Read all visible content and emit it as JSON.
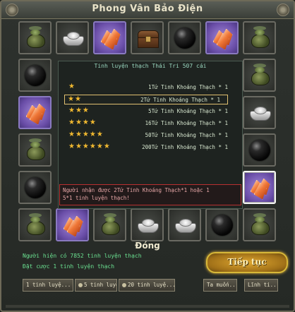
{
  "window": {
    "title": "Phong Vân Bảo Điện",
    "close_label": "Đóng"
  },
  "board": {
    "top_row": [
      "pot",
      "ingot",
      "crystal",
      "chest",
      "orb",
      "crystal",
      "pot"
    ],
    "left_col": [
      "orb",
      "crystal",
      "pot",
      "orb"
    ],
    "right_col": [
      "pot",
      "ingot",
      "orb",
      "crystal"
    ],
    "bottom_row": [
      "pot",
      "crystal",
      "pot",
      "ingot",
      "ingot",
      "orb",
      "pot"
    ],
    "selected": "right_col.3"
  },
  "panel": {
    "title": "Tinh luyện thạch Thái Tri  507 cái",
    "rows": [
      {
        "stars": "★",
        "text": "1Tứ Tinh Khoáng Thạch * 1"
      },
      {
        "stars": "★★",
        "text": "2Tứ Tinh Khoáng Thạch * 1"
      },
      {
        "stars": "★★★",
        "text": "5Tứ Tinh Khoáng Thạch * 1"
      },
      {
        "stars": "★★★★",
        "text": "16Tứ Tinh Khoáng Thạch * 1"
      },
      {
        "stars": "★★★★★",
        "text": "50Tứ Tinh Khoáng Thạch * 1"
      },
      {
        "stars": "★★★★★★",
        "text": "200Tứ Tinh Khoáng Thạch * 1"
      }
    ],
    "highlighted_row": 1,
    "notice_line1": "Người nhận được 2Tứ Tinh Khoáng Thạch*1 hoặc 1",
    "notice_line2": "5*1 tinh luyện thạch!"
  },
  "status": {
    "line1": "Người hiện có 7852 tinh luyện thạch",
    "line2": "Đặt cược  1 tinh luyện thạch"
  },
  "continue_label": "Tiếp tục",
  "buttons": [
    {
      "label": "1 tinh luyệ..."
    },
    {
      "label": "5 tinh luyệ..."
    },
    {
      "label": "20 tinh luyệ..."
    },
    {
      "label": "Ta muốn..."
    },
    {
      "label": "Lĩnh ti..."
    }
  ]
}
